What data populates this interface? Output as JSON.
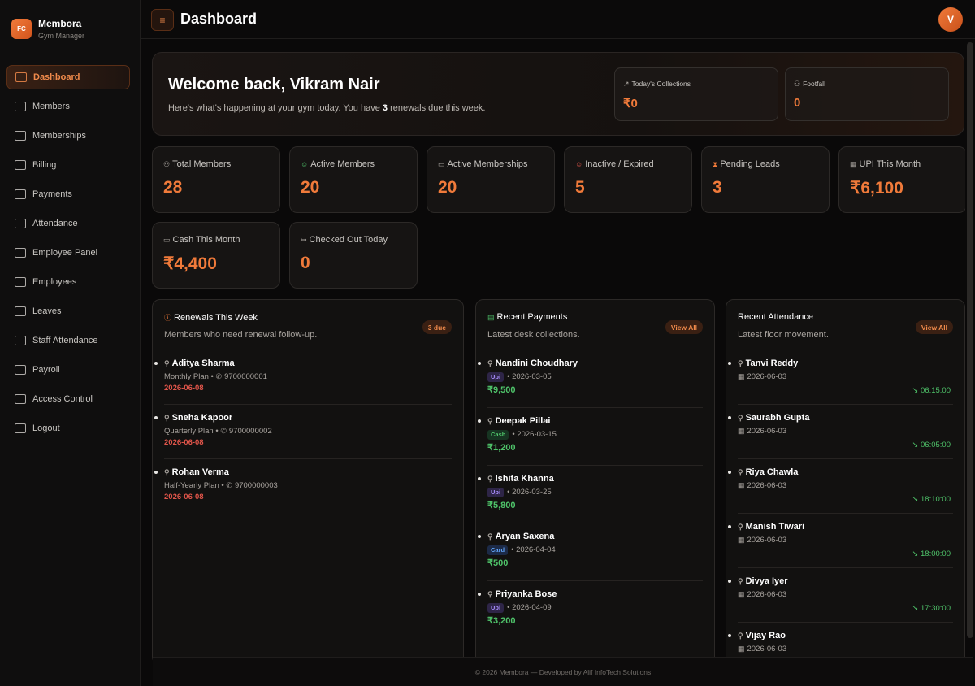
{
  "brand": {
    "logo": "FC",
    "name": "Membora",
    "subtitle": "Gym Manager"
  },
  "sidebar": {
    "items": [
      {
        "label": "Dashboard",
        "icon": "grid-icon",
        "active": true
      },
      {
        "label": "Members",
        "icon": "users-icon"
      },
      {
        "label": "Memberships",
        "icon": "cards-icon"
      },
      {
        "label": "Billing",
        "icon": "receipt-icon"
      },
      {
        "label": "Payments",
        "icon": "cash-icon"
      },
      {
        "label": "Attendance",
        "icon": "calendar-check-icon"
      },
      {
        "label": "Employee Panel",
        "icon": "badge-icon"
      },
      {
        "label": "Employees",
        "icon": "user-list-icon"
      },
      {
        "label": "Leaves",
        "icon": "calendar-x-icon"
      },
      {
        "label": "Staff Attendance",
        "icon": "clock-user-icon"
      },
      {
        "label": "Payroll",
        "icon": "bank-icon"
      },
      {
        "label": "Access Control",
        "icon": "shield-icon"
      },
      {
        "label": "Logout",
        "icon": "logout-icon"
      }
    ]
  },
  "header": {
    "title": "Dashboard",
    "menu_glyph": "≡",
    "avatar": "V"
  },
  "welcome": {
    "greeting": "Welcome back, Vikram Nair",
    "text_before": "Here's what's happening at your gym today. You have ",
    "count": "3",
    "text_after": " renewals due this week.",
    "collections_label": "Today's Collections",
    "collections_value": "₹0",
    "footfall_label": "Footfall",
    "footfall_value": "0"
  },
  "stats": [
    {
      "label": "Total Members",
      "value": "28",
      "icon": "users-icon"
    },
    {
      "label": "Active Members",
      "value": "20",
      "icon": "user-check-icon"
    },
    {
      "label": "Active Memberships",
      "value": "20",
      "icon": "cards-icon"
    },
    {
      "label": "Inactive / Expired",
      "value": "5",
      "icon": "user-x-icon"
    },
    {
      "label": "Pending Leads",
      "value": "3",
      "icon": "hourglass-icon"
    },
    {
      "label": "UPI This Month",
      "value": "₹6,100",
      "icon": "qr-icon"
    },
    {
      "label": "Cash This Month",
      "value": "₹4,400",
      "icon": "cash-icon"
    },
    {
      "label": "Checked Out Today",
      "value": "0",
      "icon": "logout-icon"
    }
  ],
  "renewals": {
    "title": "Renewals This Week",
    "subtitle": "Members who need renewal follow-up.",
    "badge": "3 due",
    "items": [
      {
        "name": "Aditya Sharma",
        "plan": "Monthly Plan",
        "phone": "9700000001",
        "date": "2026-06-08"
      },
      {
        "name": "Sneha Kapoor",
        "plan": "Quarterly Plan",
        "phone": "9700000002",
        "date": "2026-06-08"
      },
      {
        "name": "Rohan Verma",
        "plan": "Half-Yearly Plan",
        "phone": "9700000003",
        "date": "2026-06-08"
      }
    ]
  },
  "payments": {
    "title": "Recent Payments",
    "subtitle": "Latest desk collections.",
    "action": "View All",
    "items": [
      {
        "name": "Nandini Choudhary",
        "method": "Upi",
        "date": "2026-03-05",
        "amount": "₹9,500"
      },
      {
        "name": "Deepak Pillai",
        "method": "Cash",
        "date": "2026-03-15",
        "amount": "₹1,200"
      },
      {
        "name": "Ishita Khanna",
        "method": "Upi",
        "date": "2026-03-25",
        "amount": "₹5,800"
      },
      {
        "name": "Aryan Saxena",
        "method": "Card",
        "date": "2026-04-04",
        "amount": "₹500"
      },
      {
        "name": "Priyanka Bose",
        "method": "Upi",
        "date": "2026-04-09",
        "amount": "₹3,200"
      }
    ]
  },
  "attendance": {
    "title": "Recent Attendance",
    "subtitle": "Latest floor movement.",
    "action": "View All",
    "items": [
      {
        "name": "Tanvi Reddy",
        "date": "2026-06-03",
        "time": "06:15:00"
      },
      {
        "name": "Saurabh Gupta",
        "date": "2026-06-03",
        "time": "06:05:00"
      },
      {
        "name": "Riya Chawla",
        "date": "2026-06-03",
        "time": "18:10:00"
      },
      {
        "name": "Manish Tiwari",
        "date": "2026-06-03",
        "time": "18:00:00"
      },
      {
        "name": "Divya Iyer",
        "date": "2026-06-03",
        "time": "17:30:00"
      },
      {
        "name": "Vijay Rao",
        "date": "2026-06-03",
        "time": ""
      }
    ]
  },
  "footer": "© 2026 Membora — Developed by Alif InfoTech Solutions",
  "colors": {
    "accent": "#f07a3a",
    "success": "#4fc46a",
    "danger": "#e0554a"
  }
}
